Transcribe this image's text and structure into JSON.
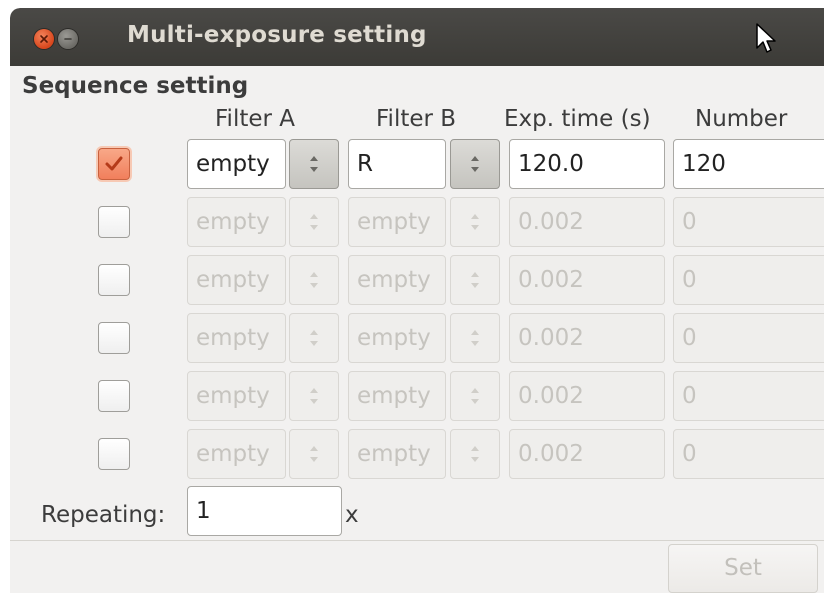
{
  "window": {
    "title": "Multi-exposure setting"
  },
  "frame": {
    "label": "Sequence setting"
  },
  "columns": {
    "filter_a": "Filter A",
    "filter_b": "Filter B",
    "exp_time": "Exp. time (s)",
    "number": "Number"
  },
  "rows": [
    {
      "checked": true,
      "enabled": true,
      "filter_a": "empty",
      "filter_b": "R",
      "exp_time": "120.0",
      "number": "120"
    },
    {
      "checked": false,
      "enabled": false,
      "filter_a": "empty",
      "filter_b": "empty",
      "exp_time": "0.002",
      "number": "0"
    },
    {
      "checked": false,
      "enabled": false,
      "filter_a": "empty",
      "filter_b": "empty",
      "exp_time": "0.002",
      "number": "0"
    },
    {
      "checked": false,
      "enabled": false,
      "filter_a": "empty",
      "filter_b": "empty",
      "exp_time": "0.002",
      "number": "0"
    },
    {
      "checked": false,
      "enabled": false,
      "filter_a": "empty",
      "filter_b": "empty",
      "exp_time": "0.002",
      "number": "0"
    },
    {
      "checked": false,
      "enabled": false,
      "filter_a": "empty",
      "filter_b": "empty",
      "exp_time": "0.002",
      "number": "0"
    }
  ],
  "repeating": {
    "label": "Repeating:",
    "value": "1",
    "suffix": "x"
  },
  "actions": {
    "set_label": "Set",
    "set_enabled": false
  },
  "colors": {
    "titlebar": "#3c3b37",
    "close_button": "#e0562c",
    "checkbox_checked": "#f17f5c",
    "window_bg": "#f2f1f0"
  },
  "icons": {
    "close": "close-icon",
    "minimize": "minimize-icon",
    "cursor": "mouse-pointer-icon",
    "check": "checkmark-icon",
    "spin": "spin-arrows-icon"
  }
}
